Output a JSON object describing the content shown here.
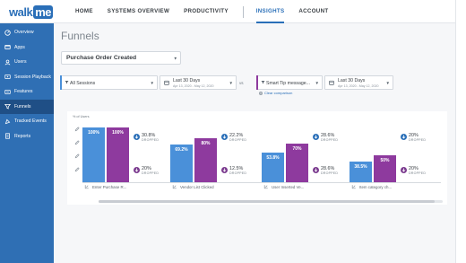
{
  "brand": {
    "logo_walk": "walk",
    "logo_me": "me"
  },
  "topnav": {
    "items": [
      {
        "label": "HOME",
        "active": false
      },
      {
        "label": "SYSTEMS OVERVIEW",
        "active": false
      },
      {
        "label": "PRODUCTIVITY",
        "active": false
      },
      {
        "label": "INSIGHTS",
        "active": true
      },
      {
        "label": "ACCOUNT",
        "active": false
      }
    ]
  },
  "sidebar": {
    "items": [
      {
        "label": "Overview",
        "icon": "overview-icon",
        "active": false
      },
      {
        "label": "Apps",
        "icon": "apps-icon",
        "active": false
      },
      {
        "label": "Users",
        "icon": "users-icon",
        "active": false
      },
      {
        "label": "Session Playback",
        "icon": "playback-icon",
        "active": false
      },
      {
        "label": "Features",
        "icon": "features-icon",
        "active": false
      },
      {
        "label": "Funnels",
        "icon": "funnel-icon",
        "active": true
      },
      {
        "label": "Tracked Events",
        "icon": "tracked-events-icon",
        "active": false
      },
      {
        "label": "Reports",
        "icon": "reports-icon",
        "active": false
      }
    ]
  },
  "page": {
    "title": "Funnels",
    "event_select": "Purchase Order Created"
  },
  "filters": {
    "segment_a": {
      "label": "All Sessions",
      "accent": "#4a90d9"
    },
    "range_a": {
      "main": "Last 30 Days",
      "sub": "Apr 13, 2020 - May 12, 2020"
    },
    "vs_label": "vs",
    "segment_b": {
      "label": "Smart Tip message...",
      "accent": "#8e3a9e"
    },
    "range_b": {
      "main": "Last 30 Days",
      "sub": "Apr 13, 2020 - May 12, 2020"
    },
    "clear_comparison": "Clear comparison"
  },
  "chart": {
    "users_axis_label": "% of Users",
    "colors": {
      "blue": "#4a90d9",
      "purple": "#8e3a9e",
      "drop_blue": "#2a6fb8",
      "drop_purple": "#7a3a8e"
    },
    "dropped_word": "DROPPED"
  },
  "chart_data": {
    "type": "bar",
    "categories": [
      "Enter Purchase R...",
      "Vendor List Clicked",
      "User Inserted Ve...",
      "Item category ch..."
    ],
    "series": [
      {
        "values": [
          100,
          69.2,
          53.8,
          38.5
        ],
        "labels": [
          "100%",
          "69.2%",
          "53.8%",
          "38.5%"
        ]
      },
      {
        "values": [
          100,
          80,
          70,
          50
        ],
        "labels": [
          "100%",
          "80%",
          "70%",
          "50%"
        ]
      }
    ],
    "dropped": [
      {
        "series_a": "30.8%",
        "series_b": "20%"
      },
      {
        "series_a": "22.2%",
        "series_b": "12.5%"
      },
      {
        "series_a": "28.6%",
        "series_b": "28.6%"
      },
      {
        "series_a": "20%",
        "series_b": "20%"
      }
    ],
    "ylim": [
      0,
      100
    ]
  }
}
